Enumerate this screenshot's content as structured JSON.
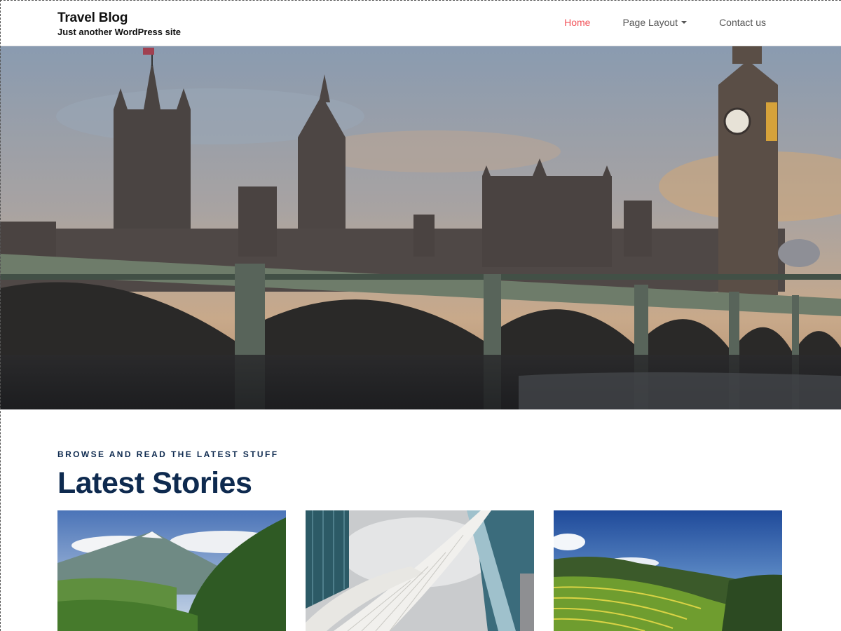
{
  "site": {
    "title": "Travel Blog",
    "tagline": "Just another WordPress site"
  },
  "nav": {
    "items": [
      {
        "label": "Home",
        "active": true
      },
      {
        "label": "Page Layout",
        "has_dropdown": true
      },
      {
        "label": "Contact us"
      }
    ]
  },
  "latest": {
    "kicker": "BROWSE AND READ THE LATEST STUFF",
    "title": "Latest Stories"
  },
  "colors": {
    "accent": "#f2545b",
    "heading": "#0e2a4f",
    "nav_text": "#555555"
  },
  "icons": {
    "dropdown": "caret-down-icon"
  }
}
